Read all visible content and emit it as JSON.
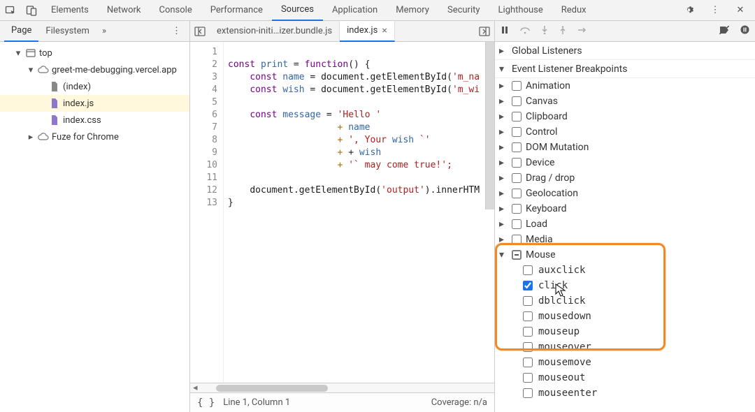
{
  "top_tabs": {
    "items": [
      {
        "label": "Elements"
      },
      {
        "label": "Network"
      },
      {
        "label": "Console"
      },
      {
        "label": "Performance"
      },
      {
        "label": "Sources",
        "active": true
      },
      {
        "label": "Application"
      },
      {
        "label": "Memory"
      },
      {
        "label": "Security"
      },
      {
        "label": "Lighthouse"
      },
      {
        "label": "Redux"
      }
    ]
  },
  "navigator": {
    "tabs": {
      "page": "Page",
      "filesystem": "Filesystem"
    },
    "tree": {
      "top": "top",
      "domain": "greet-me-debugging.vercel.app",
      "files": [
        {
          "name": "(index)",
          "type": "page"
        },
        {
          "name": "index.js",
          "type": "js",
          "selected": true
        },
        {
          "name": "index.css",
          "type": "css"
        }
      ],
      "other": "Fuze for Chrome"
    }
  },
  "editor": {
    "tabs": [
      {
        "label": "extension-initi…izer.bundle.js",
        "active": false
      },
      {
        "label": "index.js",
        "active": true
      }
    ],
    "line_count": 13,
    "code_lines": [
      "",
      "const print = function() {",
      "    const name = document.getElementById('m_na",
      "    const wish = document.getElementById('m_wi",
      "",
      "    const message = 'Hello '",
      "                    + name",
      "                    + ', Your wish `'",
      "                    + + wish",
      "                    + '` may come true!';",
      "",
      "    document.getElementById('output').innerHTM",
      "}"
    ],
    "status": {
      "pos": "Line 1, Column 1",
      "coverage": "Coverage: n/a"
    }
  },
  "right": {
    "sections": {
      "global": "Global Listeners",
      "elbp": "Event Listener Breakpoints"
    },
    "categories": [
      "Animation",
      "Canvas",
      "Clipboard",
      "Control",
      "DOM Mutation",
      "Device",
      "Drag / drop",
      "Geolocation",
      "Keyboard",
      "Load",
      "Media"
    ],
    "mouse_label": "Mouse",
    "mouse_events": [
      {
        "name": "auxclick",
        "checked": false
      },
      {
        "name": "click",
        "checked": true
      },
      {
        "name": "dblclick",
        "checked": false
      },
      {
        "name": "mousedown",
        "checked": false
      },
      {
        "name": "mouseup",
        "checked": false
      },
      {
        "name": "mouseover",
        "checked": false
      },
      {
        "name": "mousemove",
        "checked": false
      },
      {
        "name": "mouseout",
        "checked": false
      },
      {
        "name": "mouseenter",
        "checked": false
      }
    ]
  }
}
